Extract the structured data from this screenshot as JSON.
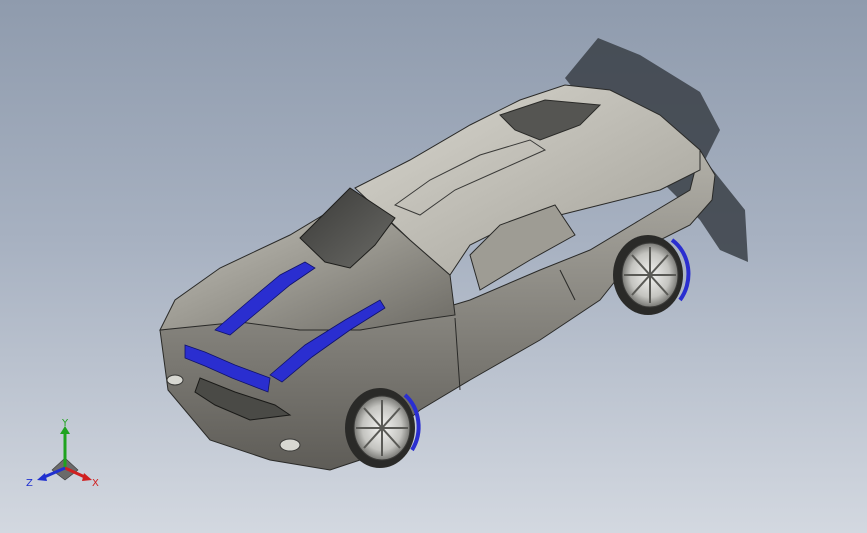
{
  "view": {
    "background_top": "#8f9bad",
    "background_bottom": "#d3d8e0",
    "model": "car-body",
    "accent_stripe_color": "#2a2ed0",
    "body_color": "#9a9890"
  },
  "triad": {
    "y_label": "Y",
    "x_label": "X",
    "z_label": "Z",
    "y_color": "#1fa31f",
    "x_color": "#d02020",
    "z_color": "#2030d0"
  }
}
